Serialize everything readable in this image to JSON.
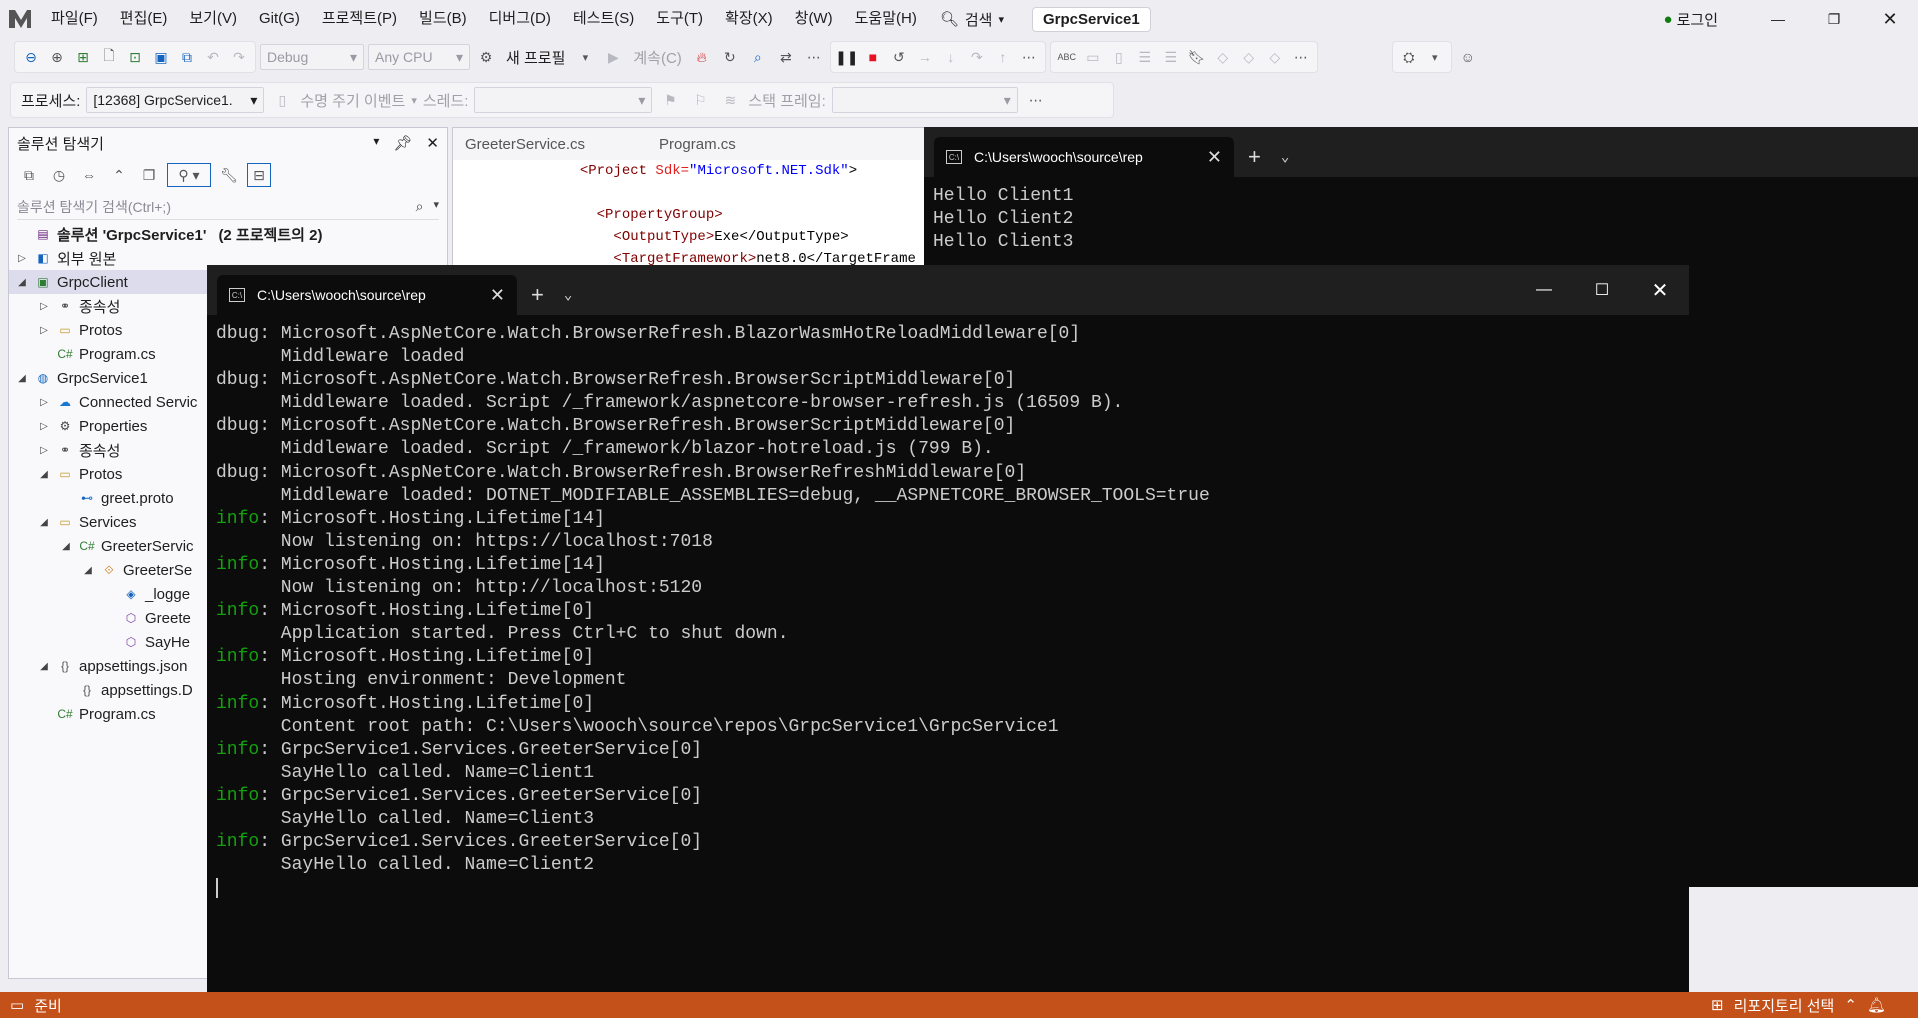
{
  "menubar": {
    "items": [
      "파일(F)",
      "편집(E)",
      "보기(V)",
      "Git(G)",
      "프로젝트(P)",
      "빌드(B)",
      "디버그(D)",
      "테스트(S)",
      "도구(T)",
      "확장(X)",
      "창(W)",
      "도움말(H)"
    ],
    "search_label": "검색",
    "solution_name": "GrpcService1",
    "login_label": "로그인"
  },
  "toolbar": {
    "config": "Debug",
    "platform": "Any CPU",
    "new_profile": "새 프로필",
    "continue": "계속(C)"
  },
  "debugbar": {
    "process_label": "프로세스:",
    "process_value": "[12368] GrpcService1.",
    "lifecycle": "수명 주기 이벤트",
    "thread_label": "스레드:",
    "stackframe_label": "스택 프레임:"
  },
  "solution_explorer": {
    "title": "솔루션 탐색기",
    "search_placeholder": "솔루션 탐색기 검색(Ctrl+;)",
    "solution_label": "솔루션 'GrpcService1'",
    "solution_count": "(2 프로젝트의 2)",
    "nodes": [
      {
        "label": "외부 원본",
        "indent": 0,
        "arrow": "▷",
        "icon": "external-icon"
      },
      {
        "label": "GrpcClient",
        "indent": 0,
        "arrow": "◢",
        "icon": "project-icon"
      },
      {
        "label": "종속성",
        "indent": 1,
        "arrow": "▷",
        "icon": "dependency-icon"
      },
      {
        "label": "Protos",
        "indent": 1,
        "arrow": "▷",
        "icon": "folder-icon"
      },
      {
        "label": "Program.cs",
        "indent": 1,
        "arrow": "",
        "icon": "csharp-icon"
      },
      {
        "label": "GrpcService1",
        "indent": 0,
        "arrow": "◢",
        "icon": "web-project-icon"
      },
      {
        "label": "Connected Servic",
        "indent": 1,
        "arrow": "▷",
        "icon": "connected-icon"
      },
      {
        "label": "Properties",
        "indent": 1,
        "arrow": "▷",
        "icon": "properties-icon"
      },
      {
        "label": "종속성",
        "indent": 1,
        "arrow": "▷",
        "icon": "dependency-icon"
      },
      {
        "label": "Protos",
        "indent": 1,
        "arrow": "◢",
        "icon": "folder-icon"
      },
      {
        "label": "greet.proto",
        "indent": 2,
        "arrow": "",
        "icon": "proto-icon"
      },
      {
        "label": "Services",
        "indent": 1,
        "arrow": "◢",
        "icon": "folder-icon"
      },
      {
        "label": "GreeterServic",
        "indent": 2,
        "arrow": "◢",
        "icon": "csharp-icon"
      },
      {
        "label": "GreeterSe",
        "indent": 3,
        "arrow": "◢",
        "icon": "class-icon"
      },
      {
        "label": "_logge",
        "indent": 4,
        "arrow": "",
        "icon": "field-icon"
      },
      {
        "label": "Greete",
        "indent": 4,
        "arrow": "",
        "icon": "method-icon"
      },
      {
        "label": "SayHe",
        "indent": 4,
        "arrow": "",
        "icon": "method-icon"
      },
      {
        "label": "appsettings.json",
        "indent": 1,
        "arrow": "◢",
        "icon": "json-icon"
      },
      {
        "label": "appsettings.D",
        "indent": 2,
        "arrow": "",
        "icon": "json-icon"
      },
      {
        "label": "Program.cs",
        "indent": 1,
        "arrow": "",
        "icon": "csharp-icon"
      }
    ]
  },
  "editor": {
    "tabs": [
      "GreeterService.cs",
      "Program.cs"
    ],
    "lines": [
      {
        "indent": "  ",
        "tag": "<Project",
        "attr": " Sdk=",
        "val": "\"Microsoft.NET.Sdk\"",
        "rest": ">"
      },
      {
        "indent": "",
        "tag": "",
        "attr": "",
        "val": "",
        "rest": ""
      },
      {
        "indent": "    ",
        "tag": "<PropertyGroup>",
        "attr": "",
        "val": "",
        "rest": ""
      },
      {
        "indent": "      ",
        "tag": "<OutputType>",
        "attr": "",
        "val": "",
        "rest": "Exe</OutputType>"
      },
      {
        "indent": "      ",
        "tag": "<TargetFramework>",
        "attr": "",
        "val": "",
        "rest": "net8.0</TargetFrame"
      }
    ]
  },
  "client_terminal": {
    "tab_title": "C:\\Users\\wooch\\source\\rep",
    "lines": [
      "Hello Client1",
      "Hello Client2",
      "Hello Client3"
    ]
  },
  "server_terminal": {
    "tab_title": "C:\\Users\\wooch\\source\\rep",
    "lines": [
      {
        "level": "dbug",
        "text": ": Microsoft.AspNetCore.Watch.BrowserRefresh.BlazorWasmHotReloadMiddleware[0]"
      },
      {
        "level": "",
        "text": "      Middleware loaded"
      },
      {
        "level": "dbug",
        "text": ": Microsoft.AspNetCore.Watch.BrowserRefresh.BrowserScriptMiddleware[0]"
      },
      {
        "level": "",
        "text": "      Middleware loaded. Script /_framework/aspnetcore-browser-refresh.js (16509 B)."
      },
      {
        "level": "dbug",
        "text": ": Microsoft.AspNetCore.Watch.BrowserRefresh.BrowserScriptMiddleware[0]"
      },
      {
        "level": "",
        "text": "      Middleware loaded. Script /_framework/blazor-hotreload.js (799 B)."
      },
      {
        "level": "dbug",
        "text": ": Microsoft.AspNetCore.Watch.BrowserRefresh.BrowserRefreshMiddleware[0]"
      },
      {
        "level": "",
        "text": "      Middleware loaded: DOTNET_MODIFIABLE_ASSEMBLIES=debug, __ASPNETCORE_BROWSER_TOOLS=true"
      },
      {
        "level": "info",
        "text": ": Microsoft.Hosting.Lifetime[14]"
      },
      {
        "level": "",
        "text": "      Now listening on: https://localhost:7018"
      },
      {
        "level": "info",
        "text": ": Microsoft.Hosting.Lifetime[14]"
      },
      {
        "level": "",
        "text": "      Now listening on: http://localhost:5120"
      },
      {
        "level": "info",
        "text": ": Microsoft.Hosting.Lifetime[0]"
      },
      {
        "level": "",
        "text": "      Application started. Press Ctrl+C to shut down."
      },
      {
        "level": "info",
        "text": ": Microsoft.Hosting.Lifetime[0]"
      },
      {
        "level": "",
        "text": "      Hosting environment: Development"
      },
      {
        "level": "info",
        "text": ": Microsoft.Hosting.Lifetime[0]"
      },
      {
        "level": "",
        "text": "      Content root path: C:\\Users\\wooch\\source\\repos\\GrpcService1\\GrpcService1"
      },
      {
        "level": "info",
        "text": ": GrpcService1.Services.GreeterService[0]"
      },
      {
        "level": "",
        "text": "      SayHello called. Name=Client1"
      },
      {
        "level": "info",
        "text": ": GrpcService1.Services.GreeterService[0]"
      },
      {
        "level": "",
        "text": "      SayHello called. Name=Client3"
      },
      {
        "level": "info",
        "text": ": GrpcService1.Services.GreeterService[0]"
      },
      {
        "level": "",
        "text": "      SayHello called. Name=Client2"
      }
    ]
  },
  "statusbar": {
    "ready": "준비",
    "repo": "리포지토리 선택"
  },
  "colors": {
    "status_bar": "#c4501a",
    "terminal_bg": "#0c0c0c",
    "info_green": "#13a10e"
  }
}
